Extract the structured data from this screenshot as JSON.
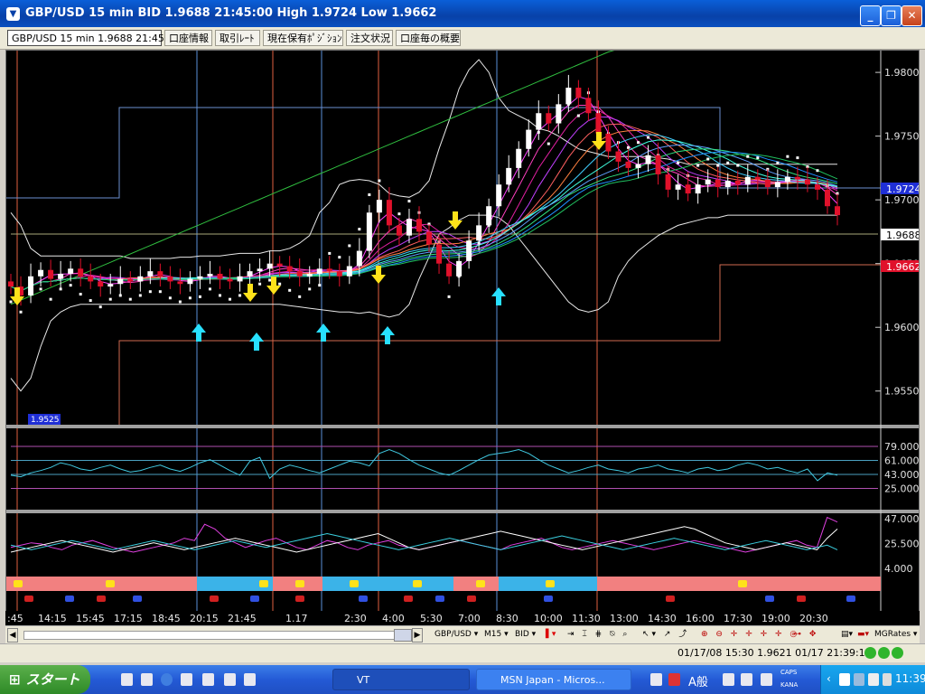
{
  "window": {
    "title": "GBP/USD 15 min BID 1.9688 21:45:00 High 1.9724 Low 1.9662",
    "min": "_",
    "max": "❐",
    "close": "✕"
  },
  "tabs": [
    {
      "label": "GBP/USD 15 min 1.9688 21:45:00"
    },
    {
      "label": "口座情報"
    },
    {
      "label": "取引ﾚｰﾄ"
    },
    {
      "label": "現在保有ﾎﾟｼﾞｼｮﾝ"
    },
    {
      "label": "注文状況"
    },
    {
      "label": "口座毎の概要"
    }
  ],
  "price_axis": {
    "ticks": [
      "1.9800",
      "1.9750",
      "1.9700",
      "1.9650",
      "1.9600",
      "1.9550"
    ],
    "high_marker": "1.9724",
    "current_marker": "1.9688",
    "low_marker": "1.9662",
    "min_label": "1.9525"
  },
  "osc1_axis": [
    "79.000",
    "61.000",
    "43.000",
    "25.000"
  ],
  "osc2_axis": [
    "47.000",
    "25.500",
    "4.000"
  ],
  "colors": {
    "bull": "#ffffff",
    "bear": "#e0112b",
    "up_arrow": "#28e0ff",
    "down_arrow": "#ffe21a",
    "high_marker": "#1f2fd6",
    "low_marker": "#e0112b",
    "band_red": "#f28080",
    "band_blue": "#3bb3e8"
  },
  "chart_data": {
    "type": "candlestick",
    "symbol": "GBP/USD",
    "timeframe": "15 min",
    "ylim": [
      1.9525,
      1.981
    ],
    "close_series": [
      1.9632,
      1.9625,
      1.964,
      1.9645,
      1.9638,
      1.9642,
      1.9646,
      1.964,
      1.9636,
      1.9632,
      1.9634,
      1.9638,
      1.9636,
      1.964,
      1.9644,
      1.964,
      1.9636,
      1.9634,
      1.9638,
      1.964,
      1.9642,
      1.9638,
      1.9636,
      1.964,
      1.9644,
      1.9646,
      1.965,
      1.9648,
      1.9644,
      1.964,
      1.9642,
      1.9646,
      1.9644,
      1.964,
      1.9648,
      1.966,
      1.969,
      1.97,
      1.968,
      1.9672,
      1.9685,
      1.9675,
      1.9665,
      1.965,
      1.964,
      1.9652,
      1.9668,
      1.968,
      1.9695,
      1.9712,
      1.9725,
      1.974,
      1.9755,
      1.9768,
      1.976,
      1.9775,
      1.9788,
      1.978,
      1.9768,
      1.9752,
      1.9738,
      1.973,
      1.9725,
      1.9728,
      1.9735,
      1.972,
      1.9708,
      1.9712,
      1.9705,
      1.9712,
      1.9716,
      1.971,
      1.9715,
      1.9712,
      1.9718,
      1.9716,
      1.971,
      1.9714,
      1.9718,
      1.9716,
      1.9712,
      1.9708,
      1.9695,
      1.9688
    ],
    "upper_band": [
      1.969,
      1.968,
      1.9662,
      1.9656,
      1.9656,
      1.9656,
      1.9656,
      1.9656,
      1.9656,
      1.9656,
      1.9656,
      1.9656,
      1.9654,
      1.9654,
      1.9654,
      1.9654,
      1.9654,
      1.9655,
      1.9655,
      1.9656,
      1.9656,
      1.9656,
      1.9657,
      1.9658,
      1.9658,
      1.9658,
      1.966,
      1.966,
      1.9662,
      1.9666,
      1.9672,
      1.969,
      1.9698,
      1.9712,
      1.9715,
      1.9716,
      1.9715,
      1.9712,
      1.9705,
      1.9703,
      1.9702,
      1.9706,
      1.9715,
      1.974,
      1.9762,
      1.9787,
      1.9802,
      1.981,
      1.98,
      1.978,
      1.977,
      1.9766,
      1.9762,
      1.9756,
      1.9754,
      1.975,
      1.9745,
      1.974,
      1.9738,
      1.9736,
      1.9734,
      1.9734,
      1.9734,
      1.9734,
      1.9734,
      1.9733,
      1.9732,
      1.973,
      1.9728,
      1.9728,
      1.9728,
      1.9728,
      1.9728,
      1.9728,
      1.9728,
      1.9728,
      1.9728,
      1.9728,
      1.9728,
      1.9728,
      1.9728,
      1.9728,
      1.9728,
      1.9728
    ],
    "lower_band": [
      1.956,
      1.955,
      1.956,
      1.9585,
      1.9605,
      1.9612,
      1.9616,
      1.9618,
      1.9618,
      1.9618,
      1.9618,
      1.9618,
      1.9618,
      1.9618,
      1.9618,
      1.9618,
      1.9618,
      1.9618,
      1.9618,
      1.9618,
      1.9618,
      1.9618,
      1.9618,
      1.9618,
      1.9618,
      1.9618,
      1.9618,
      1.9618,
      1.9617,
      1.9616,
      1.9615,
      1.9614,
      1.9613,
      1.9612,
      1.9612,
      1.9611,
      1.9612,
      1.961,
      1.9608,
      1.961,
      1.9618,
      1.9638,
      1.9655,
      1.9673,
      1.9678,
      1.9684,
      1.9688,
      1.9688,
      1.9688,
      1.9686,
      1.968,
      1.967,
      1.966,
      1.965,
      1.964,
      1.963,
      1.962,
      1.9614,
      1.9612,
      1.9614,
      1.962,
      1.964,
      1.9652,
      1.966,
      1.9666,
      1.9672,
      1.9676,
      1.968,
      1.9682,
      1.9684,
      1.9686,
      1.9686,
      1.9688,
      1.9688,
      1.9688,
      1.9688,
      1.9688,
      1.9688,
      1.9688,
      1.9688,
      1.9688,
      1.9688,
      1.9688,
      1.9688
    ],
    "time_labels": [
      ":45",
      "14:15",
      "15:45",
      "17:15",
      "18:45",
      "20:15",
      "21:45",
      "1.17",
      "2:30",
      "4:00",
      "5:30",
      "7:00",
      "8:30",
      "10:00",
      "11:30",
      "13:00",
      "14:30",
      "16:00",
      "17:30",
      "19:00",
      "20:30"
    ],
    "osc1": {
      "ylim": [
        0,
        100
      ],
      "values": [
        42,
        40,
        45,
        48,
        52,
        58,
        55,
        50,
        48,
        52,
        55,
        50,
        46,
        48,
        52,
        55,
        50,
        47,
        52,
        58,
        62,
        55,
        48,
        42,
        60,
        65,
        38,
        50,
        55,
        52,
        48,
        45,
        50,
        55,
        60,
        58,
        54,
        70,
        75,
        70,
        62,
        55,
        50,
        45,
        42,
        48,
        55,
        62,
        68,
        70,
        72,
        75,
        70,
        62,
        55,
        50,
        45,
        48,
        52,
        55,
        50,
        48,
        45,
        50,
        52,
        55,
        50,
        48,
        45,
        50,
        52,
        48,
        50,
        55,
        58,
        55,
        50,
        52,
        48,
        45,
        50,
        35,
        45,
        42
      ]
    },
    "osc2": {
      "ylim": [
        0,
        50
      ],
      "series": [
        {
          "color": "#e040e0",
          "values": [
            22,
            24,
            26,
            25,
            22,
            20,
            24,
            26,
            28,
            25,
            22,
            20,
            18,
            20,
            22,
            24,
            26,
            30,
            28,
            42,
            38,
            30,
            26,
            22,
            25,
            28,
            30,
            26,
            22,
            20,
            24,
            28,
            26,
            22,
            20,
            24,
            26,
            28,
            24,
            22,
            20,
            22,
            24,
            26,
            28,
            26,
            24,
            22,
            20,
            24,
            26,
            28,
            30,
            26,
            22,
            20,
            22,
            24,
            26,
            28,
            26,
            24,
            22,
            20,
            22,
            24,
            26,
            28,
            26,
            24,
            22,
            20,
            18,
            20,
            22,
            24,
            26,
            28,
            24,
            22,
            48,
            44
          ]
        },
        {
          "color": "#ffffff",
          "values": [
            18,
            20,
            22,
            24,
            26,
            28,
            26,
            24,
            22,
            20,
            18,
            20,
            22,
            24,
            26,
            24,
            22,
            20,
            22,
            24,
            26,
            28,
            30,
            28,
            26,
            24,
            22,
            20,
            18,
            20,
            22,
            24,
            26,
            28,
            30,
            32,
            34,
            30,
            26,
            22,
            20,
            22,
            24,
            26,
            28,
            30,
            32,
            34,
            36,
            34,
            32,
            30,
            28,
            26,
            24,
            22,
            20,
            22,
            24,
            26,
            28,
            30,
            32,
            34,
            36,
            38,
            40,
            38,
            34,
            30,
            26,
            24,
            22,
            20,
            22,
            24,
            26,
            24,
            22,
            20,
            30,
            38
          ]
        },
        {
          "color": "#3bd0e0",
          "values": [
            24,
            22,
            20,
            22,
            24,
            26,
            28,
            26,
            24,
            22,
            20,
            22,
            24,
            26,
            28,
            26,
            24,
            22,
            20,
            22,
            24,
            26,
            28,
            26,
            24,
            22,
            24,
            26,
            28,
            30,
            32,
            34,
            32,
            30,
            28,
            26,
            24,
            22,
            20,
            22,
            24,
            26,
            28,
            30,
            28,
            26,
            24,
            22,
            20,
            22,
            24,
            26,
            28,
            30,
            32,
            30,
            28,
            26,
            24,
            22,
            20,
            22,
            24,
            26,
            28,
            30,
            28,
            26,
            24,
            22,
            20,
            22,
            24,
            26,
            28,
            26,
            24,
            22,
            20,
            22,
            24,
            20
          ]
        }
      ]
    }
  },
  "toolbar": {
    "symbol": "GBP/USD ▾",
    "timeframe": "M15 ▾",
    "price_type": "BID ▾",
    "broker": "MGRates ▾"
  },
  "status": {
    "text": "01/17/08 15:30  1.9621  01/17 21:39:14"
  },
  "taskbar": {
    "start": "スタート",
    "tasks": [
      {
        "label": "VT"
      },
      {
        "label": "MSN Japan - Micros..."
      }
    ],
    "ime": "A般",
    "caps": "CAPS",
    "kana": "KANA",
    "clock": "11:39"
  }
}
